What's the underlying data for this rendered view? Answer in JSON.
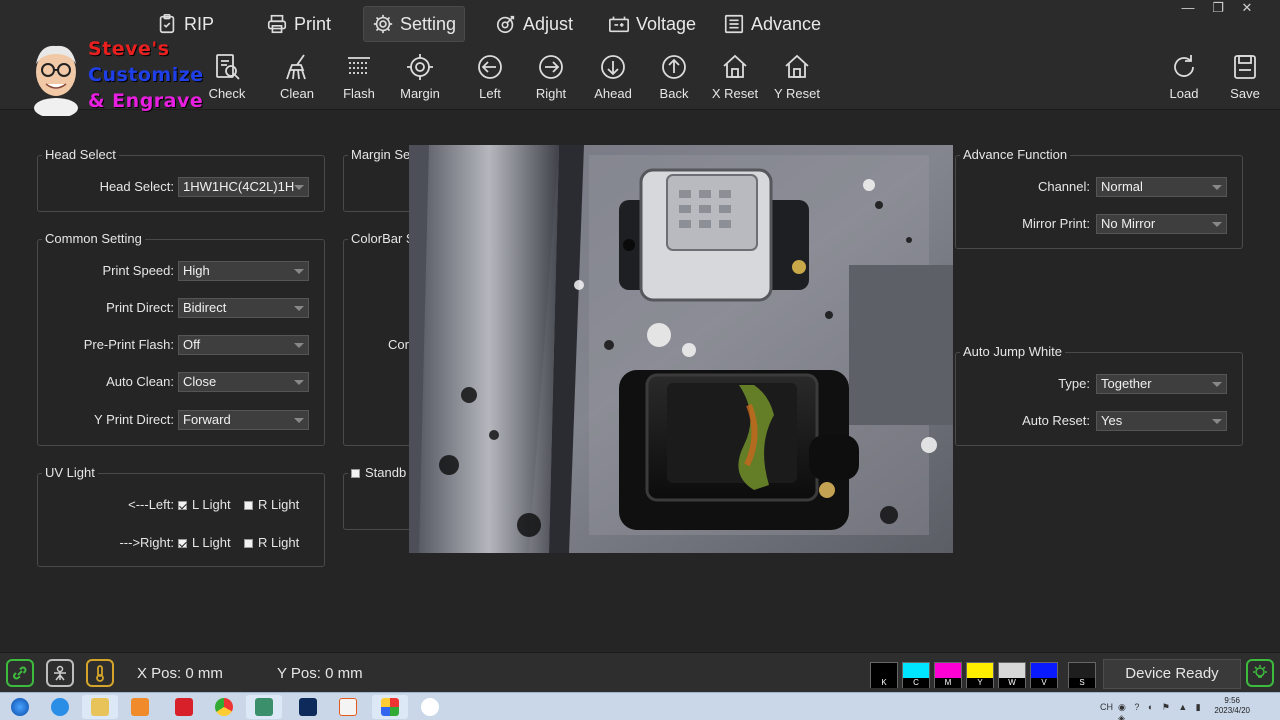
{
  "menu": {
    "items": [
      {
        "label": "RIP",
        "icon": "clipboard-check-icon"
      },
      {
        "label": "Print",
        "icon": "printer-icon"
      },
      {
        "label": "Setting",
        "icon": "gear-icon"
      },
      {
        "label": "Adjust",
        "icon": "target-adjust-icon"
      },
      {
        "label": "Voltage",
        "icon": "battery-icon"
      },
      {
        "label": "Advance",
        "icon": "list-document-icon"
      }
    ],
    "active": "Setting"
  },
  "toolbar": {
    "items": [
      {
        "label": "Check",
        "icon": "check-document-icon"
      },
      {
        "label": "Clean",
        "icon": "brush-icon"
      },
      {
        "label": "Flash",
        "icon": "flash-grid-icon"
      },
      {
        "label": "Margin",
        "icon": "margin-target-icon"
      },
      {
        "label": "Left",
        "icon": "arrow-left-circle-icon"
      },
      {
        "label": "Right",
        "icon": "arrow-right-circle-icon"
      },
      {
        "label": "Ahead",
        "icon": "arrow-down-circle-icon"
      },
      {
        "label": "Back",
        "icon": "arrow-up-circle-icon"
      },
      {
        "label": "X Reset",
        "icon": "home-icon"
      },
      {
        "label": "Y Reset",
        "icon": "home-icon"
      },
      {
        "label": "Load",
        "icon": "reload-icon"
      },
      {
        "label": "Save",
        "icon": "save-icon"
      }
    ]
  },
  "logo": {
    "line1": "Steve's",
    "line2": "Customize",
    "line3": "& Engrave",
    "colors": {
      "line1": "#e8201f",
      "line2": "#1f3fe8",
      "line3": "#e81fe0"
    }
  },
  "head_select": {
    "title": "Head Select",
    "label": "Head Select:",
    "value": "1HW1HC(4C2L)1H"
  },
  "common_setting": {
    "title": "Common Setting",
    "rows": [
      {
        "label": "Print Speed:",
        "value": "High"
      },
      {
        "label": "Print Direct:",
        "value": "Bidirect"
      },
      {
        "label": "Pre-Print Flash:",
        "value": "Off"
      },
      {
        "label": "Auto Clean:",
        "value": "Close"
      },
      {
        "label": "Y Print Direct:",
        "value": "Forward"
      }
    ]
  },
  "uv_light": {
    "title": "UV Light",
    "rows": [
      {
        "label": "<---Left:",
        "l_light": "L Light",
        "l_checked": true,
        "r_light": "R Light",
        "r_checked": false
      },
      {
        "label": "--->Right:",
        "l_light": "L Light",
        "l_checked": true,
        "r_light": "R Light",
        "r_checked": false
      }
    ]
  },
  "margin_setting": {
    "title": "Margin Se"
  },
  "colorbar_setting": {
    "title": "ColorBar S",
    "partial_label": "Cor"
  },
  "standby": {
    "label": "Standb"
  },
  "advance_function": {
    "title": "Advance Function",
    "rows": [
      {
        "label": "Channel:",
        "value": "Normal"
      },
      {
        "label": "Mirror Print:",
        "value": "No Mirror"
      }
    ]
  },
  "auto_jump_white": {
    "title": "Auto Jump White",
    "rows": [
      {
        "label": "Type:",
        "value": "Together"
      },
      {
        "label": "Auto Reset:",
        "value": "Yes"
      }
    ]
  },
  "status": {
    "x_pos": "X Pos: 0 mm",
    "y_pos": "Y Pos: 0 mm",
    "device": "Device Ready",
    "icons": [
      "link-icon",
      "nozzle-icon",
      "thermometer-icon"
    ],
    "inks": [
      {
        "letter": "K",
        "color": "#000000"
      },
      {
        "letter": "C",
        "color": "#00e5ff"
      },
      {
        "letter": "M",
        "color": "#ff00d4"
      },
      {
        "letter": "Y",
        "color": "#ffee00"
      },
      {
        "letter": "W",
        "color": "#d8d8d8"
      },
      {
        "letter": "V",
        "color": "#0a1aff"
      },
      {
        "letter": "S",
        "color": "#1e1e1e"
      }
    ],
    "status_color": "#3dbb3d"
  },
  "taskbar": {
    "time": "9:56",
    "date": "2023/4/20",
    "tray_lang": "CH"
  }
}
